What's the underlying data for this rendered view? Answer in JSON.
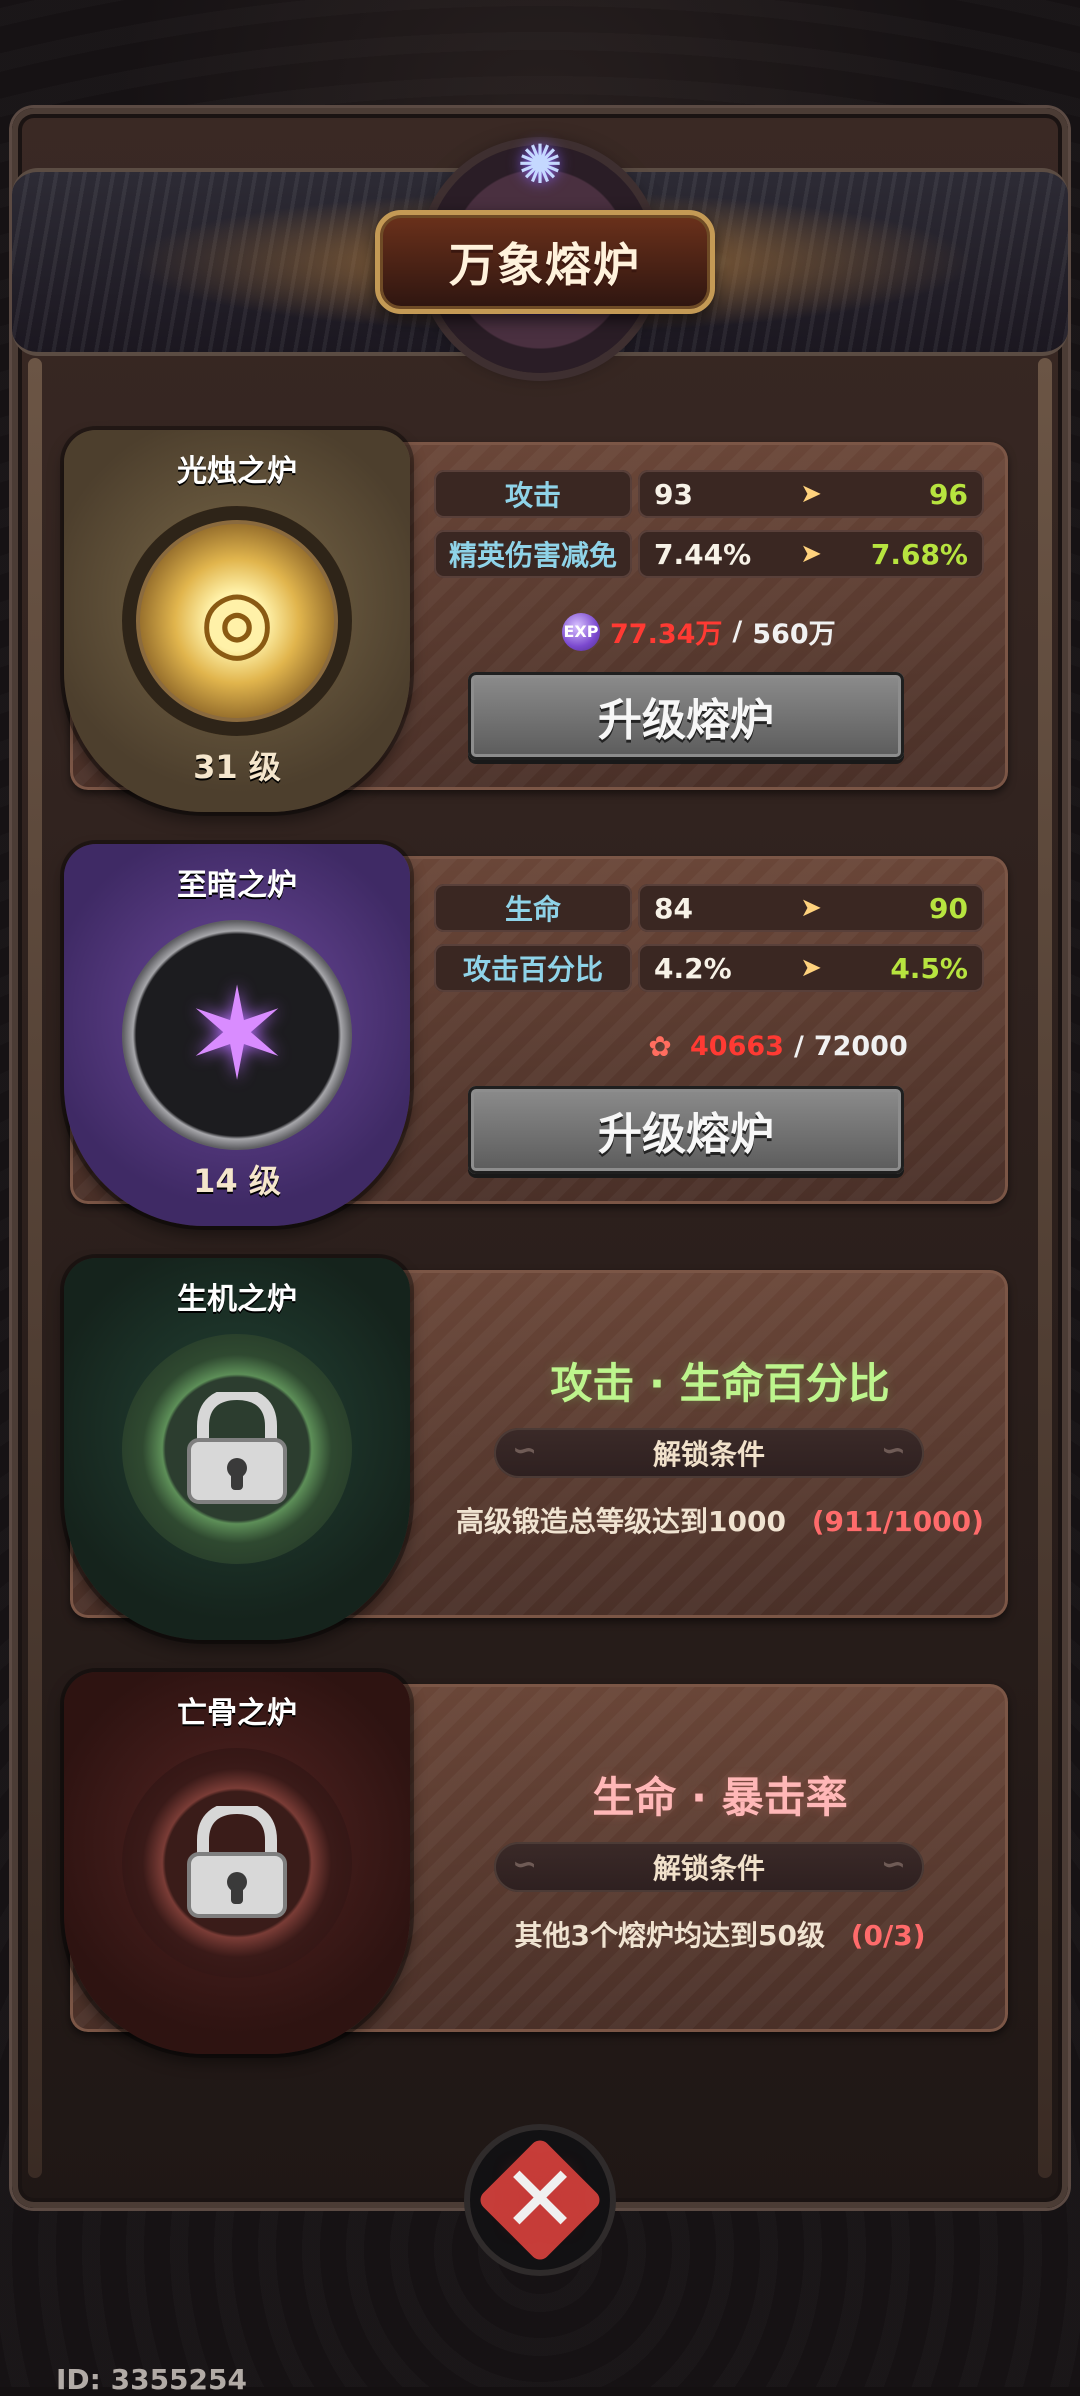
{
  "header": {
    "title": "万象熔炉"
  },
  "cards": [
    {
      "name": "光烛之炉",
      "level": "31 级",
      "theme": "gold",
      "stats": [
        {
          "label": "攻击",
          "from": "93",
          "to": "96"
        },
        {
          "label": "精英伤害减免",
          "from": "7.44%",
          "to": "7.68%"
        }
      ],
      "progress": {
        "current": "77.34万",
        "total": "560万",
        "icon": "exp-icon"
      },
      "button_label": "升级熔炉"
    },
    {
      "name": "至暗之炉",
      "level": "14 级",
      "theme": "purple",
      "stats": [
        {
          "label": "生命",
          "from": "84",
          "to": "90"
        },
        {
          "label": "攻击百分比",
          "from": "4.2%",
          "to": "4.5%"
        }
      ],
      "progress": {
        "current": "40663",
        "total": "72000",
        "icon": "flower-icon"
      },
      "button_label": "升级熔炉"
    },
    {
      "name": "生机之炉",
      "theme": "green",
      "locked": true,
      "locked_title": "攻击 · 生命百分比",
      "unlock_label": "解锁条件",
      "requirement": "高级锻造总等级达到1000",
      "requirement_progress": "(911/1000)"
    },
    {
      "name": "亡骨之炉",
      "theme": "red",
      "locked": true,
      "locked_title": "生命 · 暴击率",
      "unlock_label": "解锁条件",
      "requirement": "其他3个熔炉均达到50级",
      "requirement_progress": "(0/3)"
    }
  ],
  "footer": {
    "id_text": "ID: 3355254"
  }
}
